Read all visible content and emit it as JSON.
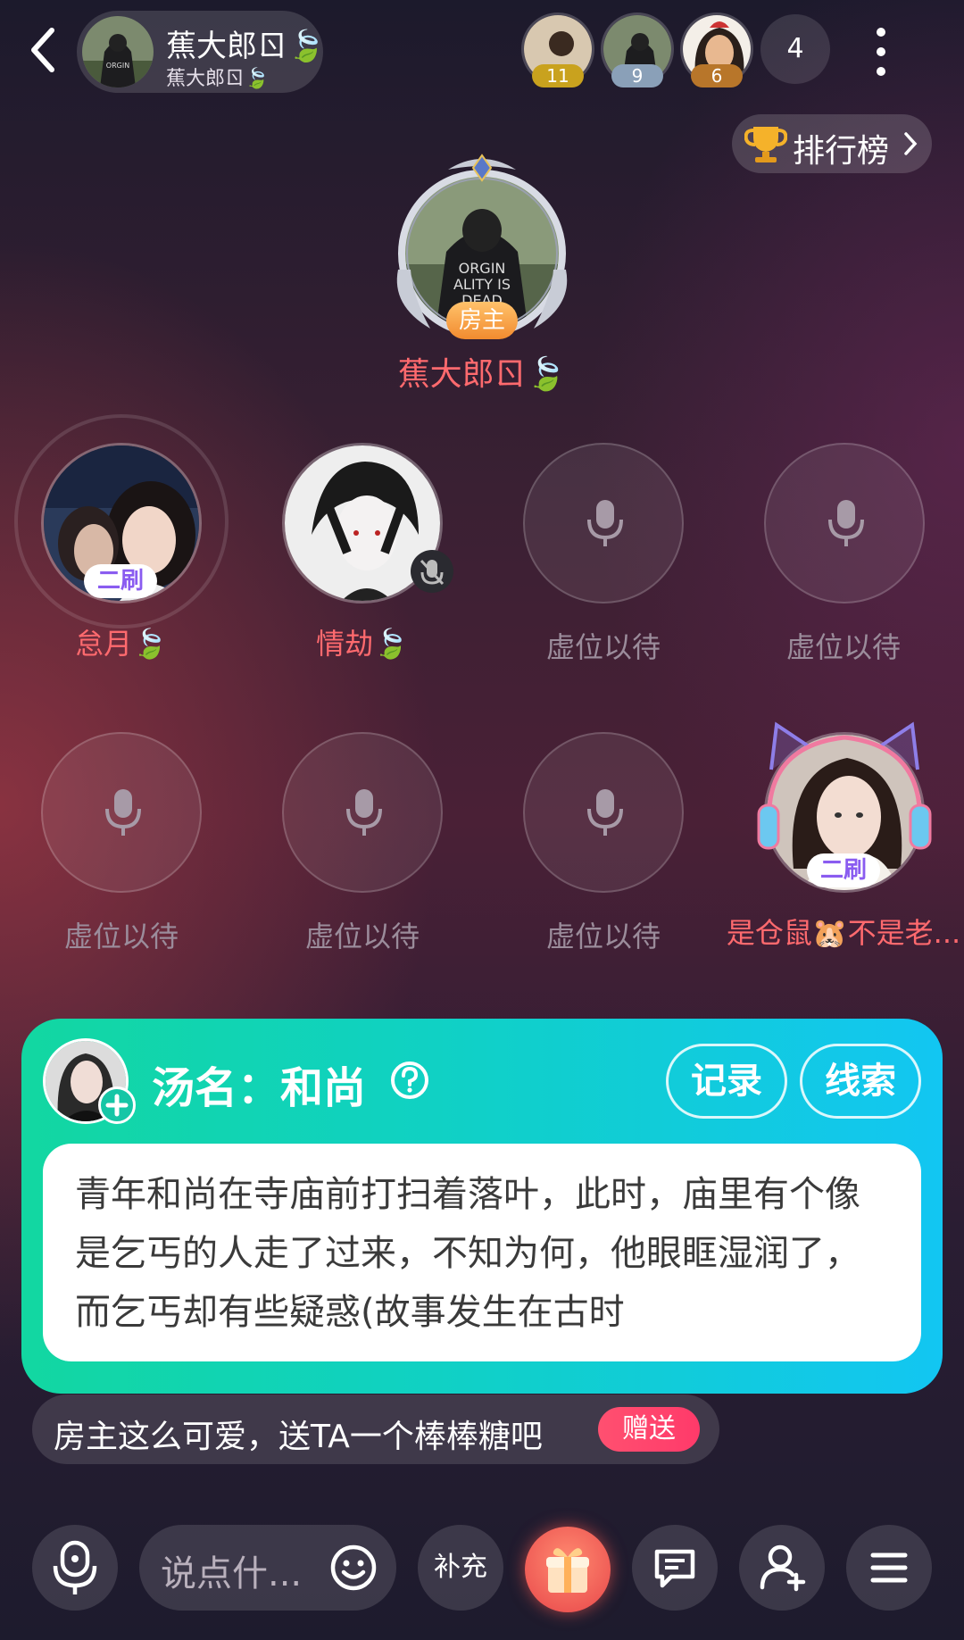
{
  "header": {
    "owner_name": "蕉大郎ㄖ🍃",
    "owner_sub": "蕉大郎ㄖ🍃",
    "audience": [
      {
        "badge": "11",
        "color": "#c9a21e"
      },
      {
        "badge": "9",
        "color": "#8aa0b8"
      },
      {
        "badge": "6",
        "color": "#b8762a"
      }
    ],
    "audience_count": "4"
  },
  "rank": {
    "label": "排行榜"
  },
  "host": {
    "tag": "房主",
    "name": "蕉大郎ㄖ🍃"
  },
  "seats": [
    {
      "label": "怠月🍃",
      "tag": "二刷"
    },
    {
      "label": "情劫🍃"
    },
    {
      "label": "虚位以待"
    },
    {
      "label": "虚位以待"
    },
    {
      "label": "虚位以待"
    },
    {
      "label": "虚位以待"
    },
    {
      "label": "虚位以待"
    },
    {
      "label": "是仓鼠🐹不是老...",
      "tag": "二刷"
    }
  ],
  "game": {
    "title": "汤名：和尚",
    "record_label": "记录",
    "clue_label": "线索",
    "story": "青年和尚在寺庙前打扫着落叶，此时，庙里有个像是乞丐的人走了过来，不知为何，他眼眶湿润了，而乞丐却有些疑惑(故事发生在古时"
  },
  "gift_tip": {
    "text": "房主这么可爱，送TA一个棒棒糖吧",
    "send": "赠送"
  },
  "bottom": {
    "chat_placeholder": "说点什...",
    "supplement": "补充"
  },
  "colors": {
    "accent_red": "#ff6a6e",
    "card_start": "#12d7a1",
    "card_end": "#12c6f2"
  }
}
